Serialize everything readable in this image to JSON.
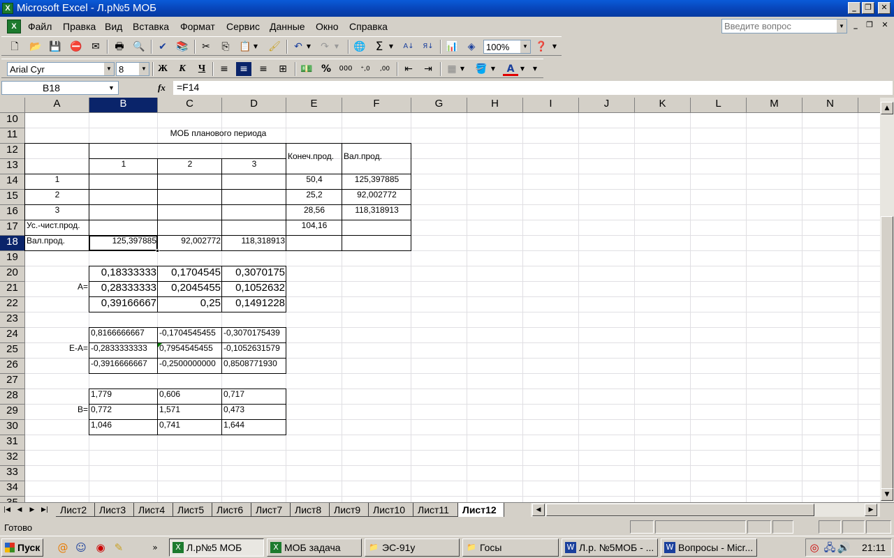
{
  "window": {
    "title": "Microsoft Excel - Л.р№5 МОБ",
    "app_icon": "excel-icon"
  },
  "menu": {
    "items": [
      "Файл",
      "Правка",
      "Вид",
      "Вставка",
      "Формат",
      "Сервис",
      "Данные",
      "Окно",
      "Справка"
    ],
    "ask_placeholder": "Введите вопрос"
  },
  "toolbar": {
    "zoom": "100%",
    "font_name": "Arial Cyr",
    "font_size": "8"
  },
  "formula_bar": {
    "name_box": "B18",
    "fx": "fx",
    "formula": "=F14"
  },
  "columns": [
    "A",
    "B",
    "C",
    "D",
    "E",
    "F",
    "G",
    "H",
    "I",
    "J",
    "K",
    "L",
    "M",
    "N"
  ],
  "rows": [
    "10",
    "11",
    "12",
    "13",
    "14",
    "15",
    "16",
    "17",
    "18",
    "19",
    "20",
    "21",
    "22",
    "23",
    "24",
    "25",
    "26",
    "27",
    "28",
    "29",
    "30",
    "31",
    "32",
    "33",
    "34",
    "35"
  ],
  "selected": {
    "column": "B",
    "row": "18"
  },
  "cells": {
    "c11": "МОБ планового периода",
    "e12": "Конеч.прод.",
    "f12": "Вал.прод.",
    "b13": "1",
    "c13": "2",
    "d13": "3",
    "a14": "1",
    "e14": "50,4",
    "f14": "125,397885",
    "a15": "2",
    "e15": "25,2",
    "f15": "92,002772",
    "a16": "3",
    "e16": "28,56",
    "f16": "118,318913",
    "a17": "Ус.-чист.прод.",
    "e17": "104,16",
    "a18": "Вал.прод.",
    "b18": "125,397885",
    "c18": "92,002772",
    "d18": "118,318913",
    "a21": "A=",
    "b20": "0,18333333",
    "c20": "0,1704545",
    "d20": "0,3070175",
    "b21": "0,28333333",
    "c21": "0,2045455",
    "d21": "0,1052632",
    "b22": "0,39166667",
    "c22": "0,25",
    "d22": "0,1491228",
    "a25": "E-A=",
    "b24": "0,8166666667",
    "c24": "-0,1704545455",
    "d24": "-0,3070175439",
    "b25": "-0,2833333333",
    "c25": "0,7954545455",
    "d25": "-0,1052631579",
    "b26": "-0,3916666667",
    "c26": "-0,2500000000",
    "d26": "0,8508771930",
    "a29": "B=",
    "b28": "1,779",
    "c28": "0,606",
    "d28": "0,717",
    "b29": "0,772",
    "c29": "1,571",
    "d29": "0,473",
    "b30": "1,046",
    "c30": "0,741",
    "d30": "1,644"
  },
  "sheets": {
    "tabs": [
      "Лист2",
      "Лист3",
      "Лист4",
      "Лист5",
      "Лист6",
      "Лист7",
      "Лист8",
      "Лист9",
      "Лист10",
      "Лист11",
      "Лист12"
    ],
    "active": "Лист12"
  },
  "status": {
    "text": "Готово"
  },
  "taskbar": {
    "start": "Пуск",
    "tasks": [
      "Л.р№5 МОБ",
      "МОБ задача",
      "ЭС-91у",
      "Госы",
      "Л.р. №5МОБ - ...",
      "Вопросы - Micr..."
    ],
    "clock": "21:11"
  }
}
